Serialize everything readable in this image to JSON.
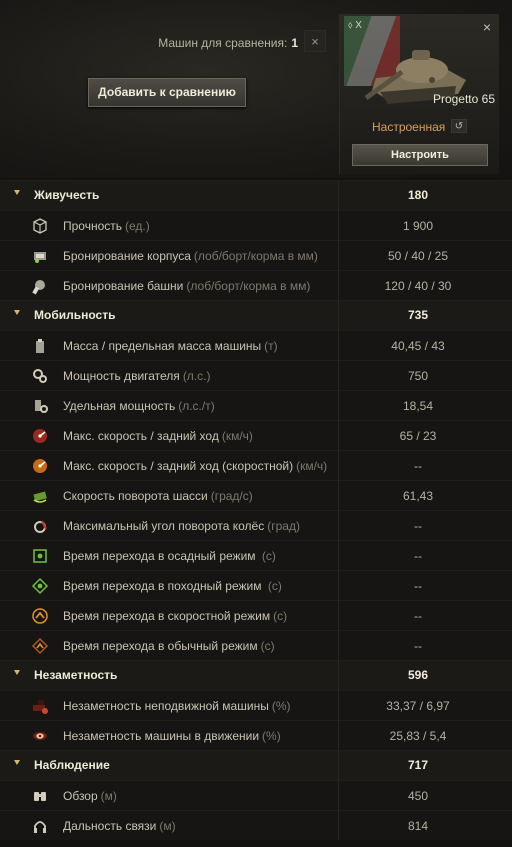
{
  "compare": {
    "count_label": "Машин для сравнения:",
    "count": "1",
    "close": "×",
    "add_button": "Добавить к сравнению"
  },
  "vehicle": {
    "name": "Progetto 65",
    "tier": "X",
    "close": "×",
    "config_state": "Настроенная",
    "configure_button": "Настроить",
    "reset_icon": "↺"
  },
  "categories": [
    {
      "name": "Живучесть",
      "value": "180",
      "stats": [
        {
          "label": "Прочность",
          "unit": "(ед.)",
          "value": "1 900",
          "icon": "durability-icon"
        },
        {
          "label": "Бронирование корпуса",
          "unit": "(лоб/борт/корма в мм)",
          "value": "50 / 40 / 25",
          "icon": "hull-armor-icon"
        },
        {
          "label": "Бронирование башни",
          "unit": "(лоб/борт/корма в мм)",
          "value": "120 / 40 / 30",
          "icon": "turret-armor-icon"
        }
      ]
    },
    {
      "name": "Мобильность",
      "value": "735",
      "stats": [
        {
          "label": "Масса / предельная масса машины",
          "unit": "(т)",
          "value": "40,45 / 43",
          "icon": "weight-icon"
        },
        {
          "label": "Мощность двигателя",
          "unit": "(л.с.)",
          "value": "750",
          "icon": "engine-power-icon"
        },
        {
          "label": "Удельная мощность",
          "unit": "(л.с./т)",
          "value": "18,54",
          "icon": "specific-power-icon"
        },
        {
          "label": "Макс. скорость / задний ход",
          "unit": "(км/ч)",
          "value": "65 / 23",
          "icon": "speed-icon"
        },
        {
          "label": "Макс. скорость / задний ход (скоростной)",
          "unit": "(км/ч)",
          "value": "--",
          "icon": "speed-fast-icon"
        },
        {
          "label": "Скорость поворота шасси",
          "unit": "(град/с)",
          "value": "61,43",
          "icon": "traverse-icon"
        },
        {
          "label": "Максимальный угол поворота колёс",
          "unit": "(град)",
          "value": "--",
          "icon": "wheel-angle-icon"
        },
        {
          "label": "Время перехода в осадный режим",
          "unit": " (с)",
          "value": "--",
          "icon": "siege-mode-icon"
        },
        {
          "label": "Время перехода в походный режим",
          "unit": " (с)",
          "value": "--",
          "icon": "travel-mode-icon"
        },
        {
          "label": "Время перехода в скоростной режим",
          "unit": "(с)",
          "value": "--",
          "icon": "speed-mode-icon"
        },
        {
          "label": "Время перехода в обычный режим",
          "unit": "(с)",
          "value": "--",
          "icon": "normal-mode-icon"
        }
      ]
    },
    {
      "name": "Незаметность",
      "value": "596",
      "stats": [
        {
          "label": "Незаметность неподвижной машины",
          "unit": "(%)",
          "value": "33,37 / 6,97",
          "icon": "camo-stationary-icon"
        },
        {
          "label": "Незаметность машины в движении",
          "unit": "(%)",
          "value": "25,83 / 5,4",
          "icon": "camo-moving-icon"
        }
      ]
    },
    {
      "name": "Наблюдение",
      "value": "717",
      "stats": [
        {
          "label": "Обзор",
          "unit": "(м)",
          "value": "450",
          "icon": "view-range-icon"
        },
        {
          "label": "Дальность связи",
          "unit": "(м)",
          "value": "814",
          "icon": "radio-range-icon"
        }
      ]
    }
  ]
}
